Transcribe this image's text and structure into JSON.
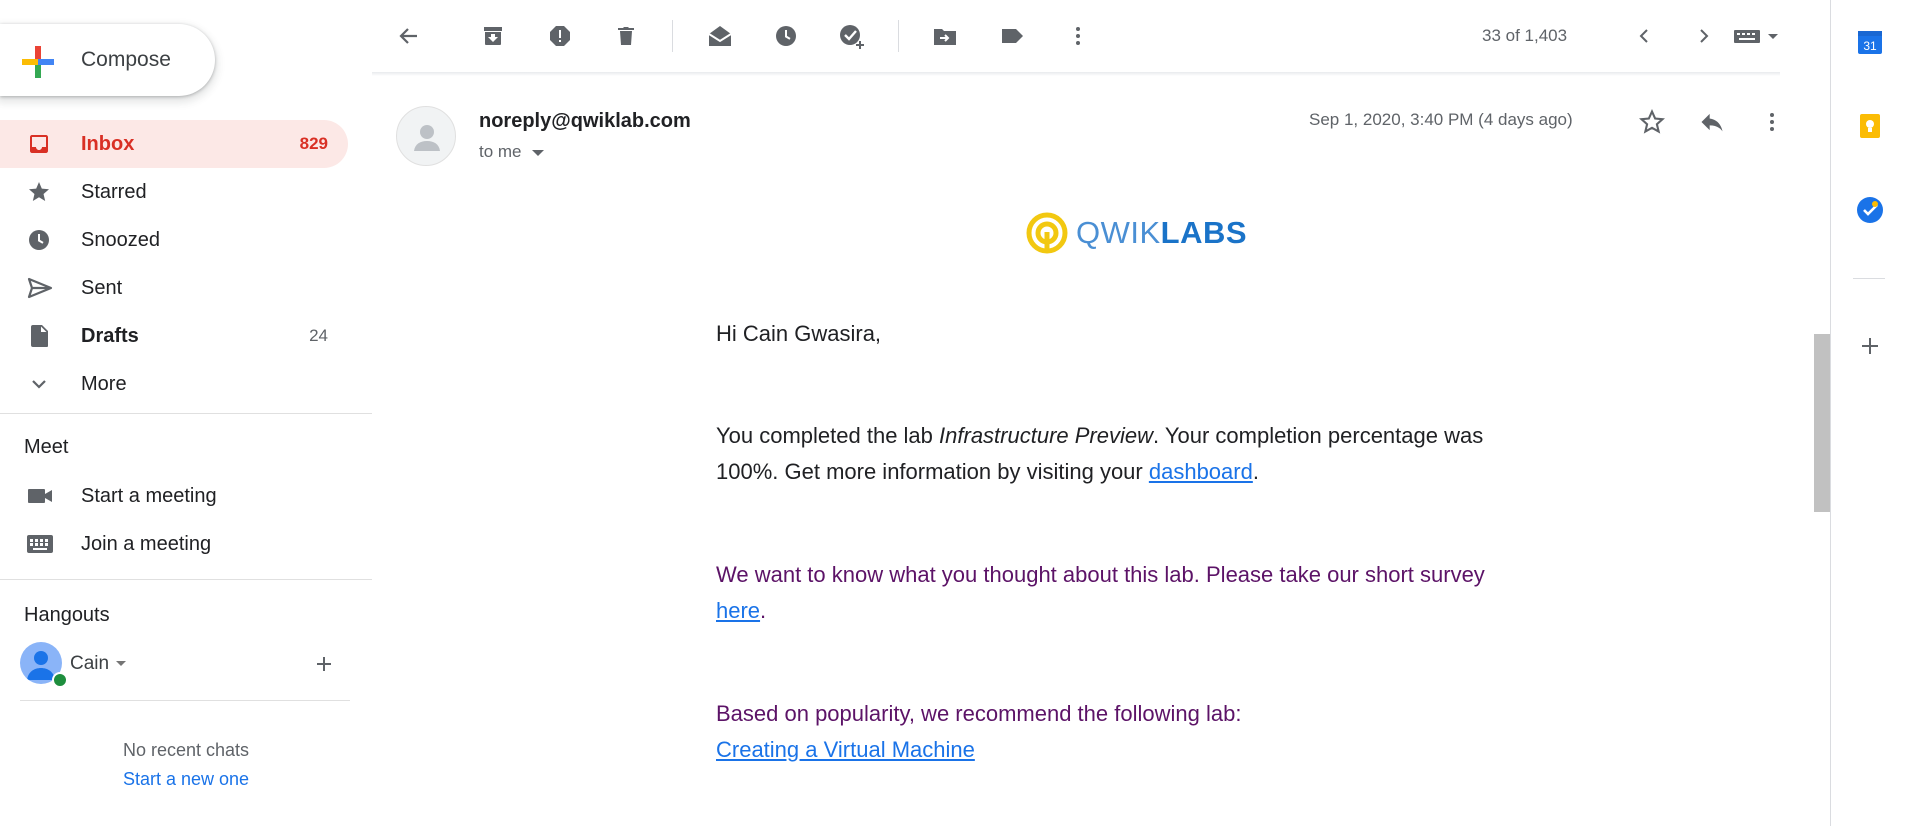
{
  "compose": {
    "label": "Compose"
  },
  "nav": {
    "inbox": {
      "label": "Inbox",
      "count": "829",
      "icon": "inbox-icon"
    },
    "starred": {
      "label": "Starred",
      "icon": "star-icon"
    },
    "snoozed": {
      "label": "Snoozed",
      "icon": "clock-icon"
    },
    "sent": {
      "label": "Sent",
      "icon": "send-icon"
    },
    "drafts": {
      "label": "Drafts",
      "count": "24",
      "icon": "draft-icon"
    },
    "more": {
      "label": "More",
      "icon": "chevron-down-icon"
    }
  },
  "meet": {
    "heading": "Meet",
    "start": {
      "label": "Start a meeting",
      "icon": "video-camera-icon"
    },
    "join": {
      "label": "Join a meeting",
      "icon": "keyboard-icon"
    }
  },
  "hangouts": {
    "heading": "Hangouts",
    "user": "Cain",
    "no_recent": "No recent chats",
    "start_new": "Start a new one"
  },
  "toolbar": {
    "icons": [
      "back-arrow-icon",
      "archive-icon",
      "report-spam-icon",
      "delete-icon",
      "mark-unread-icon",
      "snooze-icon",
      "add-task-icon",
      "move-to-icon",
      "label-icon",
      "more-vert-icon",
      "older-chevron-icon",
      "newer-chevron-icon",
      "input-tools-icon"
    ],
    "count": "33 of 1,403"
  },
  "message": {
    "sender": "noreply@qwiklab.com",
    "recipient": "to me",
    "date": "Sep 1, 2020, 3:40 PM (4 days ago)",
    "logo": {
      "light": "QWIK",
      "bold": "LABS"
    },
    "greeting": "Hi Cain Gwasira,",
    "p1": {
      "before": "You completed the lab ",
      "lab_name": "Infrastructure Preview",
      "after": ". Your completion percentage was 100%. Get more information by visiting your ",
      "link": "dashboard",
      "end": "."
    },
    "p2": {
      "before": "We want to know what you thought about this lab. Please take our short survey ",
      "link": "here",
      "end": "."
    },
    "p3": {
      "text": "Based on popularity, we recommend the following lab:",
      "link": "Creating a Virtual Machine"
    }
  },
  "side_panel": {
    "apps": [
      "calendar-icon",
      "keep-icon",
      "tasks-icon",
      "add-addon-icon"
    ],
    "calendar_day": "31"
  },
  "colors": {
    "inbox_active_bg": "#fce8e6",
    "inbox_red": "#d93025",
    "link_blue": "#1a73e8",
    "purple_text": "#5c1367",
    "qwiklabs_yellow": "#f2c811",
    "qwiklabs_blue": "#4a8fd4"
  }
}
